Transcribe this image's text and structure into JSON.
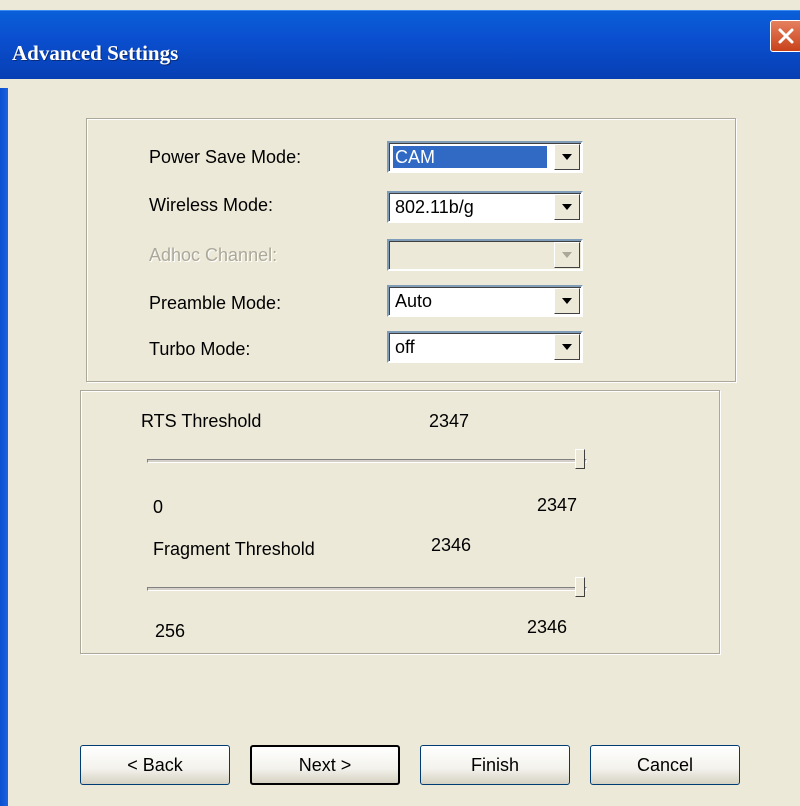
{
  "window": {
    "title": "Advanced Settings"
  },
  "settings": {
    "power_save_label": "Power Save Mode:",
    "power_save_value": "CAM",
    "wireless_mode_label": "Wireless Mode:",
    "wireless_mode_value": "802.11b/g",
    "adhoc_channel_label": "Adhoc Channel:",
    "adhoc_channel_value": "",
    "preamble_label": "Preamble Mode:",
    "preamble_value": "Auto",
    "turbo_label": "Turbo Mode:",
    "turbo_value": "off"
  },
  "thresholds": {
    "rts": {
      "label": "RTS Threshold",
      "value": "2347",
      "min": "0",
      "max": "2347"
    },
    "fragment": {
      "label": "Fragment Threshold",
      "value": "2346",
      "min": "256",
      "max": "2346"
    }
  },
  "buttons": {
    "back": "< Back",
    "next": "Next >",
    "finish": "Finish",
    "cancel": "Cancel"
  },
  "icons": {
    "close": "close-icon",
    "dropdown": "chevron-down-icon"
  },
  "colors": {
    "titlebar": "#0a4fcf",
    "face": "#ece9d8",
    "selection": "#316ac5",
    "close": "#c8421b"
  }
}
